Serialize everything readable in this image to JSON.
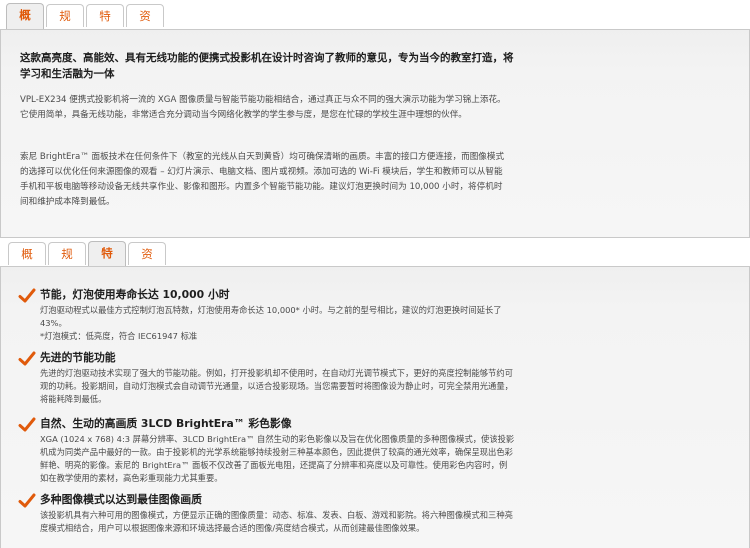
{
  "tabs_top": [
    "概述",
    "规格",
    "特点",
    "资源"
  ],
  "tabs_top_active": 0,
  "tabs_bottom": [
    "概述",
    "规格",
    "特点",
    "资源"
  ],
  "tabs_bottom_active": 2,
  "overview": {
    "title": "这款高亮度、高能效、具有无线功能的便携式投影机在设计时咨询了教师的意见，专为当今的教室打造，将学习和生活融为一体",
    "paragraphs": [
      "VPL-EX234 便携式投影机将一流的 XGA 图像质量与智能节能功能相结合，通过真正与众不同的强大演示功能为学习锦上添花。它使用简单，具备无线功能，非常适合充分调动当今网络化教学的学生参与度，是您在忙碌的学校生涯中理想的伙伴。",
      "索尼 BrightEra™ 面板技术在任何条件下（教室的光线从白天到黄昏）均可确保清晰的画质。丰富的接口方便连接，而图像模式的选择可以优化任何来源图像的观看 – 幻灯片演示、电脑文档、图片或视频。添加可选的 Wi-Fi 模块后，学生和教师可以从智能手机和平板电脑等移动设备无线共享作业、影像和图形。内置多个智能节能功能。建议灯泡更换时间为 10,000 小时，将停机时间和维护成本降到最低。"
    ]
  },
  "features": [
    {
      "title": "节能，灯泡使用寿命长达 10,000 小时",
      "desc": "灯泡驱动程式以最佳方式控制灯泡瓦特数，灯泡使用寿命长达 10,000* 小时。与之前的型号相比，建议的灯泡更换时间延长了 43%。",
      "note": "*灯泡模式：低亮度，符合 IEC61947 标准"
    },
    {
      "title": "先进的节能功能",
      "desc": "先进的灯泡驱动技术实现了强大的节能功能。例如，打开投影机却不使用时，在自动灯光调节模式下，更好的亮度控制能够节约可观的功耗。投影期间，自动灯泡模式会自动调节光通量，以适合投影现场。当您需要暂时将图像设为静止时，可完全禁用光通量，将能耗降到最低。",
      "note": ""
    },
    {
      "title": "自然、生动的高画质 3LCD BrightEra™ 彩色影像",
      "desc": "XGA (1024 x 768) 4:3 屏幕分辨率、3LCD BrightEra™ 自然生动的彩色影像以及旨在优化图像质量的多种图像模式，使该投影机成为同类产品中最好的一款。由于投影机的光学系统能够持续投射三种基本颜色，因此提供了较高的通光效率，确保呈现出色彩鲜艳、明亮的影像。索尼的 BrightEra™ 面板不仅改善了面板光电阻，还提高了分辨率和亮度以及可靠性。使用彩色内容时，例如在教学使用的素材，高色彩重现能力尤其重要。",
      "note": ""
    },
    {
      "title": "多种图像模式以达到最佳图像画质",
      "desc": "该投影机具有六种可用的图像模式，方便显示正确的图像质量：动态、标准、发表、白板、游戏和影院。将六种图像模式和三种亮度模式相结合，用户可以根据图像来源和环境选择最合适的图像/亮度结合模式，从而创建最佳图像效果。",
      "note": ""
    }
  ],
  "colors": {
    "accent": "#e05a0b",
    "panel_bg": "#efefef",
    "border": "#c9c9c9"
  },
  "icons": {
    "feature_bullet": "checkmark-icon"
  }
}
